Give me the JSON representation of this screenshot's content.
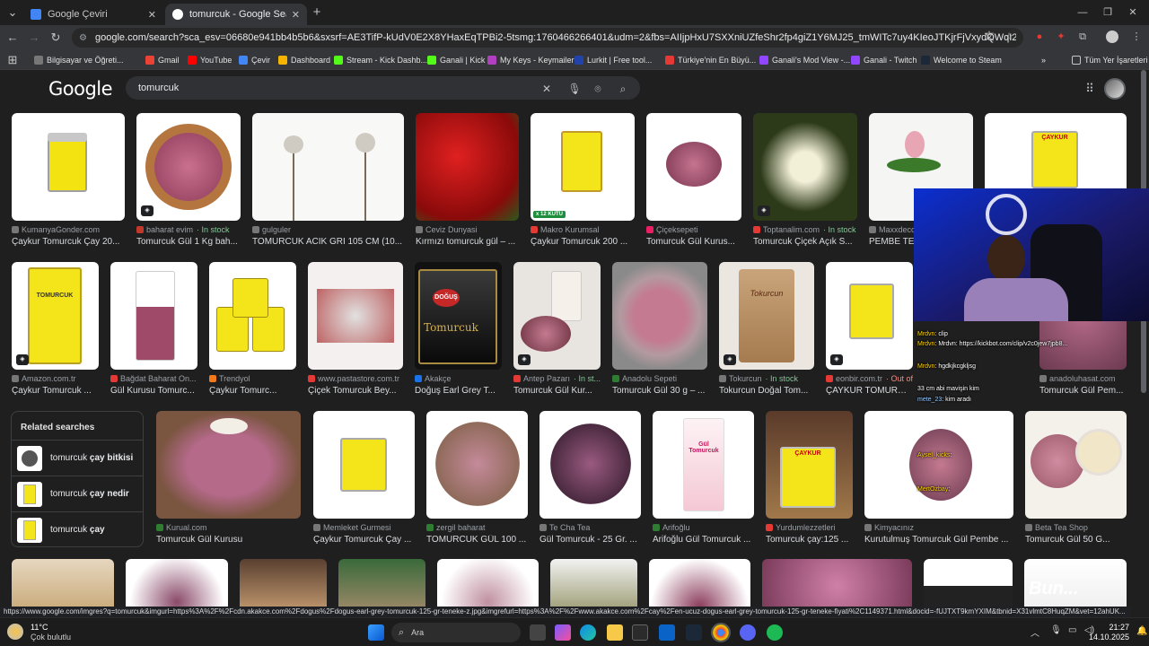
{
  "browser": {
    "tabs": [
      {
        "label": "Google Çeviri",
        "active": false
      },
      {
        "label": "tomurcuk - Google Search",
        "active": true
      }
    ],
    "new_tab": "+",
    "url": "google.com/search?sca_esv=06680e941bb4b5b6&sxsrf=AE3TifP-kUdV0E2X8YHaxEqTPBi2-5tsmg:1760466266401&udm=2&fbs=AIIjpHxU7SXXniUZfeShr2fp4giZ1Y6MJ25_tmWITc7uy4KIeoJTKjrFjVxydQWqI2NcOhY6EW5YXyX8qVhXkcpJI65...",
    "bookmarks": [
      "Bilgisayar ve Öğreti...",
      "Gmail",
      "YouTube",
      "Çevir",
      "Dashboard",
      "Stream - Kick Dashb...",
      "Ganali | Kick",
      "My Keys - Keymailer",
      "Lurkit | Free tool...",
      "Türkiye'nin En Büyü...",
      "Ganali's Mod View -...",
      "Ganali - Twitch",
      "Welcome to Steam"
    ],
    "other_bookmarks": "Tüm Yer İşaretleri",
    "status_url": "https://www.google.com/imgres?q=tomurcuk&imgurl=https%3A%2F%2Fcdn.akakce.com%2Fdogus%2Fdogus-earl-grey-tomurcuk-125-gr-teneke-z.jpg&imgrefurl=https%3A%2F%2Fwww.akakce.com%2Fcay%2Fen-ucuz-dogus-earl-grey-tomurcuk-125-gr-teneke-fiyati%2C1149371.html&docid=-fUJTXT9kmYXIM&tbnid=X31vlmtC8HuqZM&vet=12ahUK..."
  },
  "google": {
    "logo": "Google",
    "query": "tomurcuk",
    "related_title": "Related searches",
    "related": [
      {
        "prefix": "tomurcuk ",
        "bold": "çay bitkisi"
      },
      {
        "prefix": "tomurcuk ",
        "bold": "çay nedir"
      },
      {
        "prefix": "tomurcuk ",
        "bold": "çay"
      }
    ],
    "row1": [
      {
        "source": "KumanyaGonder.com",
        "stock": "",
        "title": "Çaykur Tomurcuk Çay 20..."
      },
      {
        "source": "baharat evim",
        "stock": "· In stock",
        "title": "Tomurcuk Gül 1 Kg bah..."
      },
      {
        "source": "gulguler",
        "stock": "",
        "title": "TOMURCUK ACIK GRI 105 CM (10..."
      },
      {
        "source": "Ceviz Dunyasi",
        "stock": "",
        "title": "Kırmızı tomurcuk gül – ..."
      },
      {
        "source": "Makro Kurumsal",
        "stock": "",
        "title": "Çaykur Tomurcuk 200 ...",
        "badge": "x 12 KUTU"
      },
      {
        "source": "Çiçeksepeti",
        "stock": "",
        "title": "Tomurcuk Gül Kurus..."
      },
      {
        "source": "Toptanalim.com",
        "stock": "· In stock",
        "title": "Tomurcuk Çiçek Açık S..."
      },
      {
        "source": "Maxxdeco",
        "stock": "",
        "title": "PEMBE TE..."
      },
      {
        "source": "",
        "stock": "",
        "title": ""
      }
    ],
    "row2": [
      {
        "source": "Amazon.com.tr",
        "stock": "",
        "title": "Çaykur Tomurcuk ..."
      },
      {
        "source": "Bağdat Baharat On...",
        "stock": "",
        "title": "Gül Kurusu Tomurc..."
      },
      {
        "source": "Trendyol",
        "stock": "",
        "title": "Çaykur Tomurc..."
      },
      {
        "source": "www.pastastore.com.tr",
        "stock": "",
        "title": "Çiçek Tomurcuk Bey..."
      },
      {
        "source": "Akakçe",
        "stock": "",
        "title": "Doğuş Earl Grey T..."
      },
      {
        "source": "Antep Pazarı",
        "stock": "· In st...",
        "title": "Tomurcuk Gül Kur..."
      },
      {
        "source": "Anadolu Sepeti",
        "stock": "",
        "title": "Tomurcuk Gül 30 g – ..."
      },
      {
        "source": "Tokurcun",
        "stock": "· In stock",
        "title": "Tokurcun Doğal Tom..."
      },
      {
        "source": "eonbir.com.tr",
        "stock": "· Out of...",
        "title": "ÇAYKUR TOMURCU..."
      },
      {
        "source": "anadoluhasat.com",
        "stock": "",
        "title": "Tomurcuk Gül Pem..."
      }
    ],
    "row3": [
      {
        "source": "Kurual.com",
        "stock": "",
        "title": "Tomurcuk Gül Kurusu"
      },
      {
        "source": "Memleket Gurmesi",
        "stock": "",
        "title": "Çaykur Tomurcuk Çay ..."
      },
      {
        "source": "zergil baharat",
        "stock": "",
        "title": "TOMURCUK GÜL 100 ..."
      },
      {
        "source": "Te Cha Tea",
        "stock": "",
        "title": "Gül Tomurcuk - 25 Gr. ..."
      },
      {
        "source": "Arifoğlu",
        "stock": "",
        "title": "Arifoğlu Gül Tomurcuk ..."
      },
      {
        "source": "Yurdumlezzetleri",
        "stock": "",
        "title": "Tomurcuk çay:125 ..."
      },
      {
        "source": "Kimyacınız",
        "stock": "",
        "title": "Kurutulmuş Tomurcuk Gül Pembe ..."
      },
      {
        "source": "Beta Tea Shop",
        "stock": "",
        "title": "Tomurcuk Gül 50 G..."
      }
    ],
    "product_labels": {
      "caykur": "ÇAYKUR",
      "tomurcuk": "TOMURCUK",
      "dogus": "DOĞUŞ",
      "tokurcun": "Tokurcun",
      "gul_tomurcuk": "Gül Tomurcuk"
    }
  },
  "stream_overlay": {
    "chat": [
      {
        "user": "Mrdvn",
        "msg": ": clip"
      },
      {
        "user": "Mrdvn",
        "msg": ": Mrdvn: https://kickbot.com/clip/v2c0jew7jpb8..."
      },
      {
        "user": "Mrdvn",
        "msg": ": hgdkjkcgkljsg"
      },
      {
        "user": "",
        "msg": "33 cm abi mavişin kim"
      },
      {
        "user": "mete_23",
        "msg": ": kim aradı"
      },
      {
        "user": "Aysel_kicks",
        "msg": ": "
      },
      {
        "user": "MertOzbay",
        "msg": ": "
      }
    ],
    "watermark": "Bun..."
  },
  "taskbar": {
    "temp": "11°C",
    "weather": "Çok bulutlu",
    "search": "Ara",
    "time": "21:27",
    "date": "14.10.2025"
  },
  "colors": {
    "accent": "#8ab4f8",
    "stock": "#81c995",
    "page_bg": "#1f1f1f"
  }
}
